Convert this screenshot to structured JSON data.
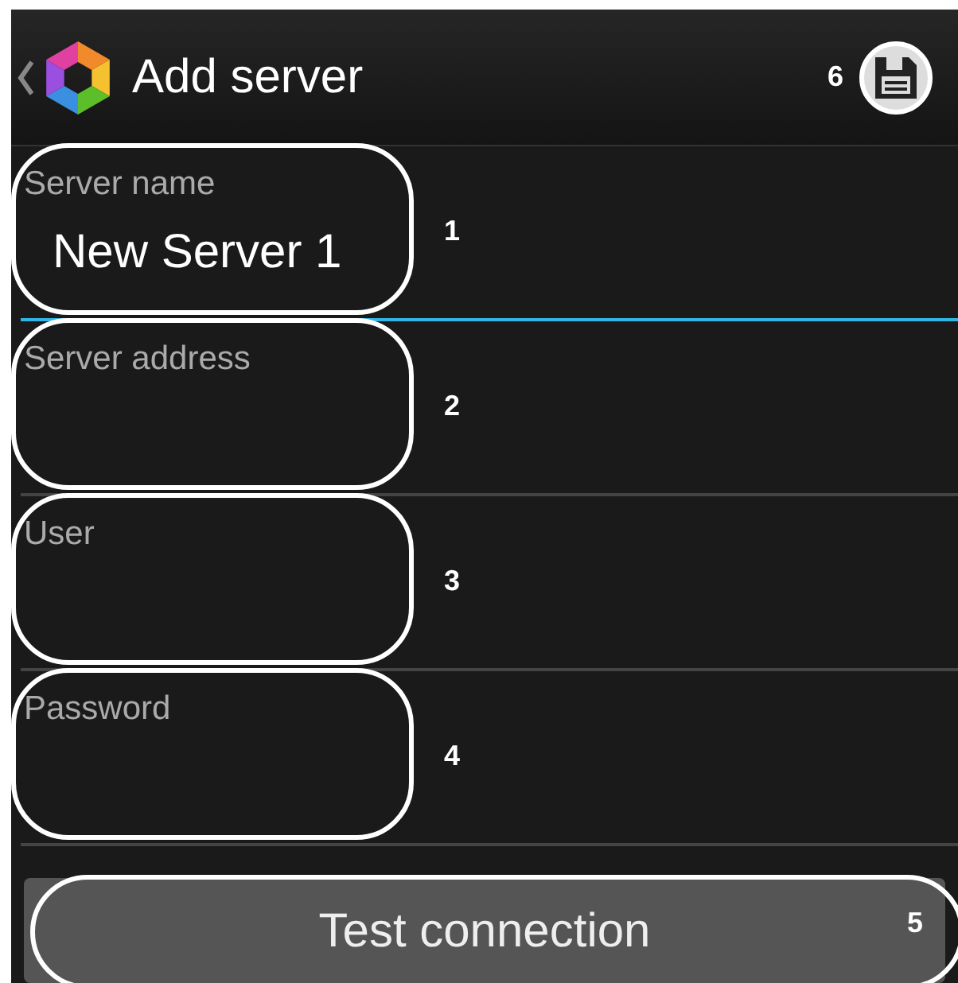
{
  "header": {
    "title": "Add server",
    "callout": "6"
  },
  "fields": [
    {
      "label": "Server name",
      "value": "New Server 1",
      "focused": true,
      "callout": "1"
    },
    {
      "label": "Server address",
      "focused": false,
      "callout": "2"
    },
    {
      "label": "User",
      "focused": false,
      "callout": "3"
    },
    {
      "label": "Password",
      "focused": false,
      "callout": "4"
    }
  ],
  "button": {
    "label": "Test connection",
    "callout": "5"
  }
}
